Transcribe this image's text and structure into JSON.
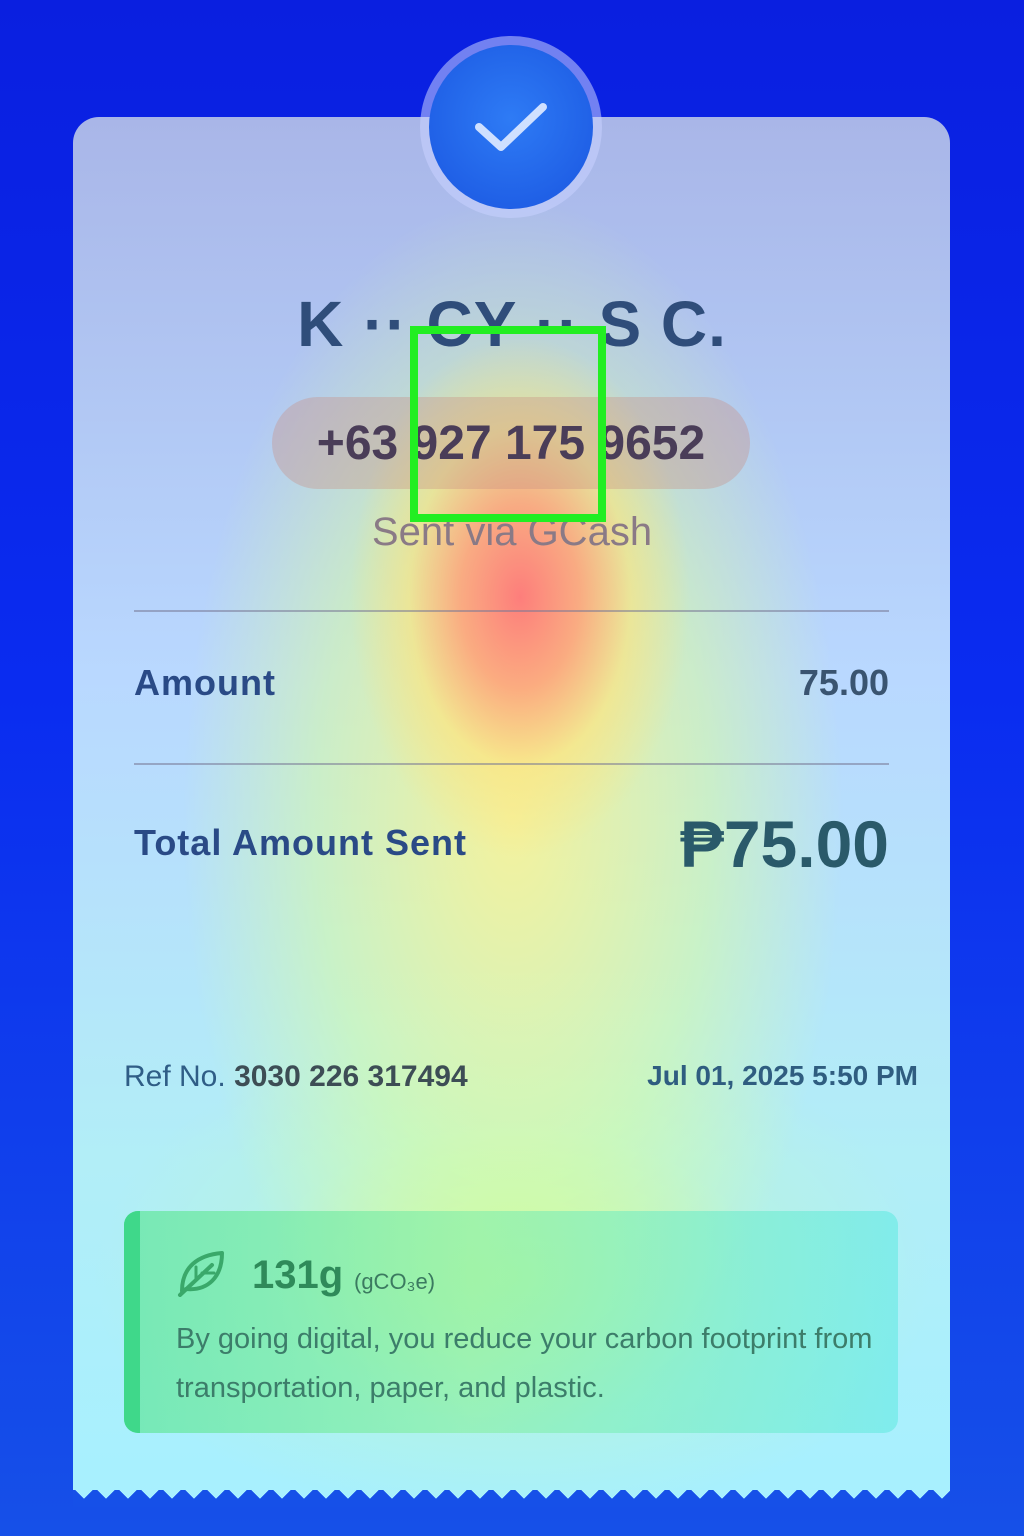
{
  "recipient": {
    "name": "K ·· CY ·· S C.",
    "phone": "+63 927 175 9652",
    "sent_via": "Sent via GCash"
  },
  "amount_row": {
    "label": "Amount",
    "value": "75.00"
  },
  "total_row": {
    "label": "Total Amount Sent",
    "value": "₱75.00"
  },
  "reference": {
    "prefix": "Ref No.",
    "number": "3030 226 317494",
    "datetime": "Jul 01, 2025 5:50 PM"
  },
  "eco": {
    "icon": "leaf-icon",
    "amount": "131g",
    "unit": "(gCO₃e)",
    "message": "By going digital, you reduce your carbon footprint from transportation, paper, and plastic."
  },
  "status_icon": "check-icon",
  "colors": {
    "background": "#0a2cf0",
    "accent": "#1a55e0",
    "eco_bar": "#3fd88a",
    "focus_box": "#22ee22"
  }
}
